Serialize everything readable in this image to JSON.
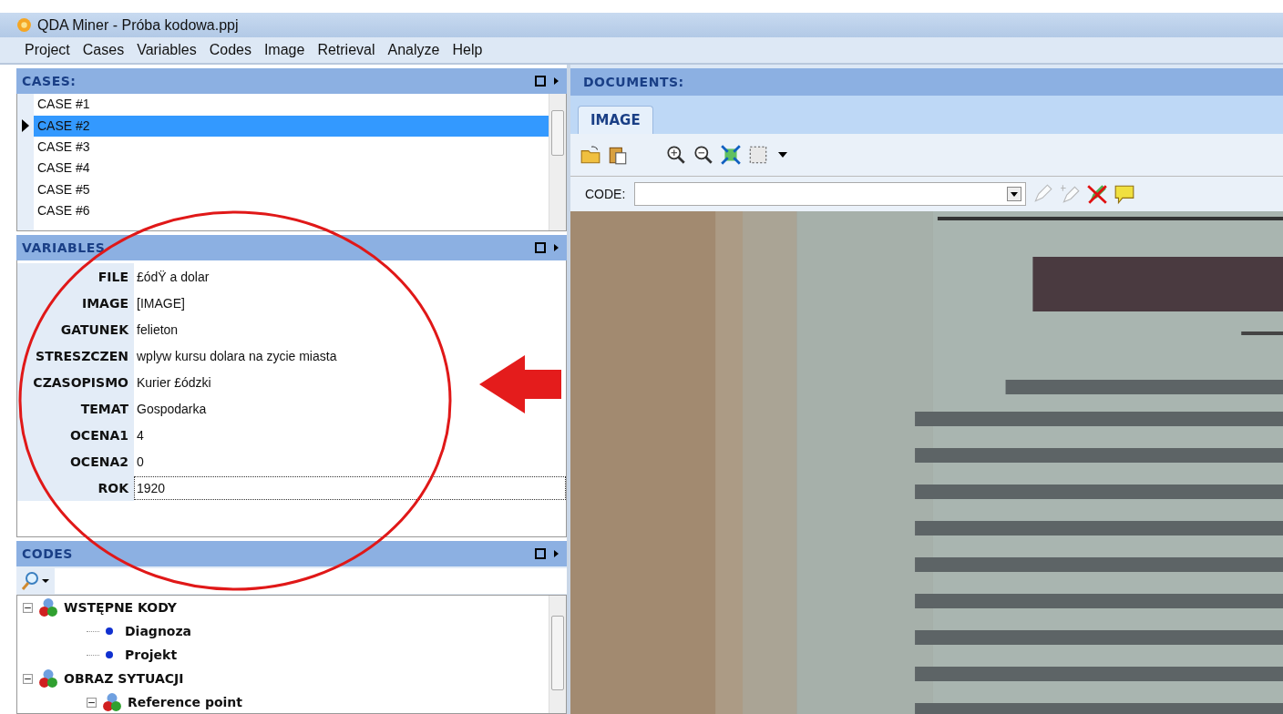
{
  "window": {
    "title": "QDA Miner - Próba kodowa.ppj"
  },
  "menu": [
    "Project",
    "Cases",
    "Variables",
    "Codes",
    "Image",
    "Retrieval",
    "Analyze",
    "Help"
  ],
  "cases": {
    "title": "CASES:",
    "items": [
      {
        "label": "CASE #1",
        "selected": false
      },
      {
        "label": "CASE #2",
        "selected": true
      },
      {
        "label": "CASE #3",
        "selected": false
      },
      {
        "label": "CASE #4",
        "selected": false
      },
      {
        "label": "CASE #5",
        "selected": false
      },
      {
        "label": "CASE #6",
        "selected": false
      }
    ]
  },
  "variables": {
    "title": "VARIABLES",
    "rows": [
      {
        "name": "FILE",
        "value": "£ódŸ a dolar",
        "focused": false
      },
      {
        "name": "IMAGE",
        "value": "[IMAGE]",
        "focused": false
      },
      {
        "name": "GATUNEK",
        "value": "felieton",
        "focused": false
      },
      {
        "name": "STRESZCZEN",
        "value": "wplyw kursu dolara na zycie miasta",
        "focused": false
      },
      {
        "name": "CZASOPISMO",
        "value": "Kurier £ódzki",
        "focused": false
      },
      {
        "name": "TEMAT",
        "value": "Gospodarka",
        "focused": false
      },
      {
        "name": "OCENA1",
        "value": "4",
        "focused": false
      },
      {
        "name": "OCENA2",
        "value": "0",
        "focused": false
      },
      {
        "name": "ROK",
        "value": "1920",
        "focused": true
      }
    ]
  },
  "codes": {
    "title": "CODES",
    "tree": [
      {
        "label": "WSTĘPNE KODY",
        "kind": "group",
        "expanded": true,
        "children": [
          {
            "label": "Diagnoza",
            "kind": "code"
          },
          {
            "label": "Projekt",
            "kind": "code"
          }
        ]
      },
      {
        "label": "OBRAZ SYTUACJI",
        "kind": "group",
        "expanded": true,
        "children": [
          {
            "label": "Reference point",
            "kind": "group",
            "expanded": true
          }
        ]
      }
    ]
  },
  "documents": {
    "title": "DOCUMENTS:",
    "tabs": [
      {
        "label": "IMAGE",
        "selected": true
      }
    ],
    "code_label": "CODE:"
  }
}
